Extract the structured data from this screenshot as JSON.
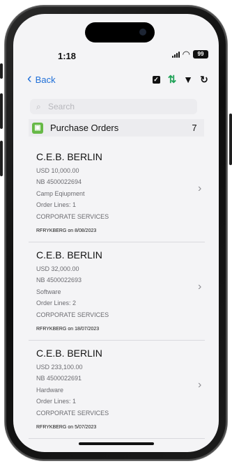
{
  "status_bar": {
    "time": "1:18",
    "battery": "99"
  },
  "navigation": {
    "back_label": "Back"
  },
  "icons": {
    "back": "chevron-left-icon",
    "select": "checkbox-icon",
    "sort": "sort-icon",
    "filter": "filter-icon",
    "refresh": "refresh-icon",
    "search": "search-icon",
    "cart": "shopping-cart-icon",
    "disclosure": "chevron-right-icon"
  },
  "search": {
    "placeholder": "Search"
  },
  "section": {
    "title": "Purchase Orders",
    "count": "7"
  },
  "orders": [
    {
      "supplier": "C.E.B. BERLIN",
      "amount": "USD 10,000.00",
      "number": "NB 4500022694",
      "category": "Camp Eqiupment",
      "order_lines": "Order Lines: 1",
      "department": "CORPORATE SERVICES",
      "created": "RFRYKBERG on 8/08/2023"
    },
    {
      "supplier": "C.E.B. BERLIN",
      "amount": "USD 32,000.00",
      "number": "NB 4500022693",
      "category": "Software",
      "order_lines": "Order Lines: 2",
      "department": "CORPORATE SERVICES",
      "created": "RFRYKBERG on 18/07/2023"
    },
    {
      "supplier": "C.E.B. BERLIN",
      "amount": "USD 233,100.00",
      "number": "NB 4500022691",
      "category": "Hardware",
      "order_lines": "Order Lines: 1",
      "department": "CORPORATE SERVICES",
      "created": "RFRYKBERG on 5/07/2023"
    }
  ],
  "colors": {
    "accent": "#1f6fd8",
    "sort_icon": "#23a35a",
    "purchase_orders_icon": "#67b947"
  }
}
